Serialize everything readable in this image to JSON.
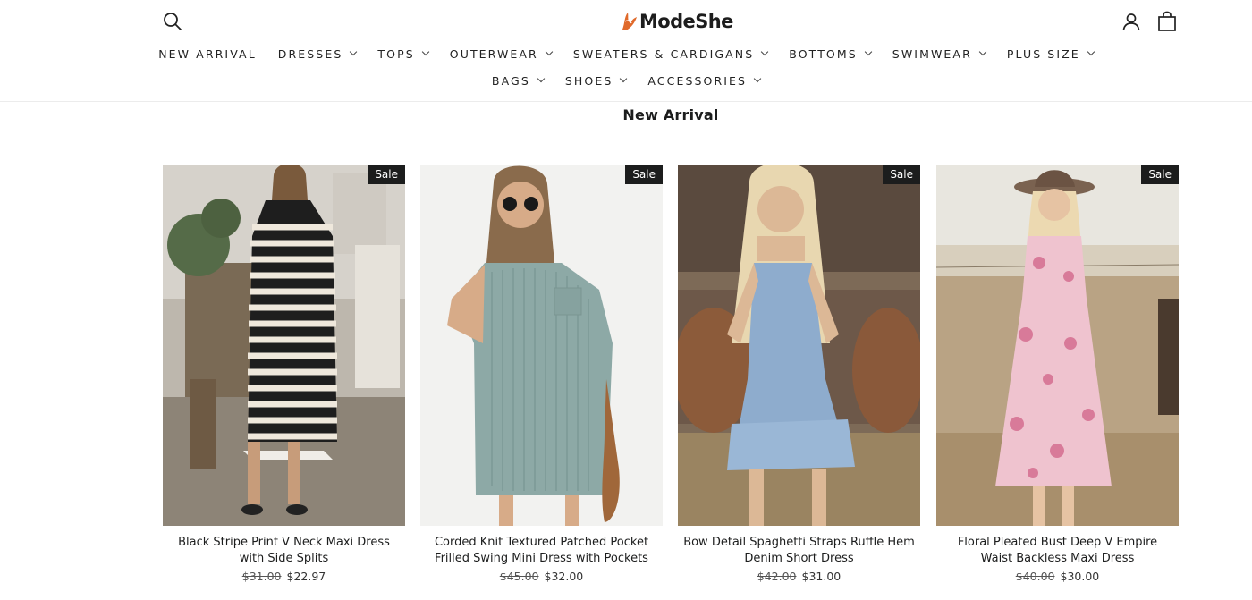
{
  "header": {
    "logo_text": "ModeShe",
    "nav_row1": [
      {
        "label": "NEW ARRIVAL",
        "dropdown": false
      },
      {
        "label": "DRESSES",
        "dropdown": true
      },
      {
        "label": "TOPS",
        "dropdown": true
      },
      {
        "label": "OUTERWEAR",
        "dropdown": true
      },
      {
        "label": "SWEATERS & CARDIGANS",
        "dropdown": true
      },
      {
        "label": "BOTTOMS",
        "dropdown": true
      },
      {
        "label": "SWIMWEAR",
        "dropdown": true
      },
      {
        "label": "PLUS SIZE",
        "dropdown": true
      }
    ],
    "nav_row2": [
      {
        "label": "BAGS",
        "dropdown": true
      },
      {
        "label": "SHOES",
        "dropdown": true
      },
      {
        "label": "ACCESSORIES",
        "dropdown": true
      }
    ],
    "icons": {
      "search": "search-icon",
      "account": "user-icon",
      "cart": "shopping-bag-icon"
    }
  },
  "main": {
    "section_title": "New Arrival",
    "products": [
      {
        "title": "Black Stripe Print V Neck Maxi Dress with Side Splits",
        "old_price": "$31.00",
        "price": "$22.97",
        "badge": "Sale"
      },
      {
        "title": "Corded Knit Textured Patched Pocket Frilled Swing Mini Dress with Pockets",
        "old_price": "$45.00",
        "price": "$32.00",
        "badge": "Sale"
      },
      {
        "title": "Bow Detail Spaghetti Straps Ruffle Hem Denim Short Dress",
        "old_price": "$42.00",
        "price": "$31.00",
        "badge": "Sale"
      },
      {
        "title": "Floral Pleated Bust Deep V Empire Waist Backless Maxi Dress",
        "old_price": "$40.00",
        "price": "$30.00",
        "badge": "Sale"
      }
    ]
  },
  "colors": {
    "text": "#1c1d1d",
    "badge_bg": "#1c1d1d",
    "logo_accent": "#e0692a"
  }
}
